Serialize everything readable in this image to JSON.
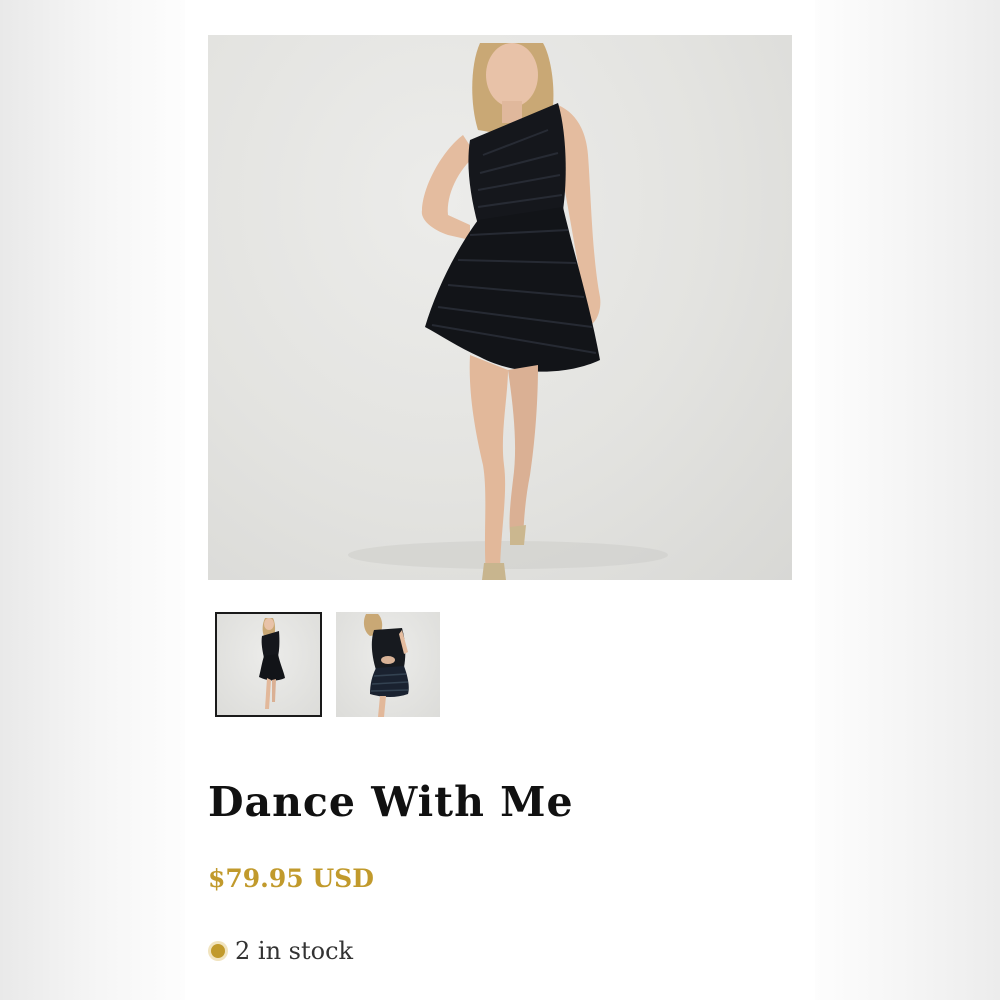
{
  "product": {
    "title": "Dance With Me",
    "price": "$79.95 USD",
    "stock": "2 in stock"
  },
  "gallery": {
    "main_image": "black-one-shoulder-pleated-dress-front",
    "thumbnails": [
      {
        "name": "dress-front-thumbnail",
        "selected": true
      },
      {
        "name": "dress-back-thumbnail",
        "selected": false
      }
    ]
  },
  "colors": {
    "price": "#c19a2c",
    "stock_dot": "#c19a2c",
    "title": "#111111",
    "thumbnail_selected_border": "#1a1a1a"
  }
}
